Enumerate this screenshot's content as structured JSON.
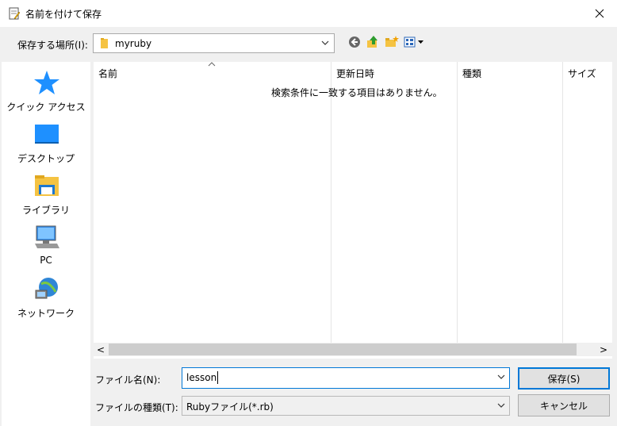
{
  "window": {
    "title": "名前を付けて保存",
    "close_icon": "close-icon"
  },
  "toolbar": {
    "location_label": "保存する場所(I):",
    "location_value": "myruby",
    "icons": [
      "back-icon",
      "up-folder-icon",
      "new-folder-icon",
      "view-menu-icon"
    ]
  },
  "places": [
    {
      "label": "クイック アクセス",
      "icon": "star-icon"
    },
    {
      "label": "デスクトップ",
      "icon": "desktop-icon"
    },
    {
      "label": "ライブラリ",
      "icon": "library-icon"
    },
    {
      "label": "PC",
      "icon": "computer-icon"
    },
    {
      "label": "ネットワーク",
      "icon": "network-icon"
    }
  ],
  "file_list": {
    "columns": [
      "名前",
      "更新日時",
      "種類",
      "サイズ"
    ],
    "empty_message": "検索条件に一致する項目はありません。"
  },
  "scrollbar": {
    "left_arrow": "<",
    "right_arrow": ">"
  },
  "form": {
    "filename_label": "ファイル名(N):",
    "filename_value": "lesson",
    "filetype_label": "ファイルの種類(T):",
    "filetype_value": "Rubyファイル(*.rb)"
  },
  "buttons": {
    "save": "保存(S)",
    "cancel": "キャンセル"
  },
  "colors": {
    "accent": "#0078d7",
    "star": "#1e90ff",
    "folder": "#f5c342"
  }
}
